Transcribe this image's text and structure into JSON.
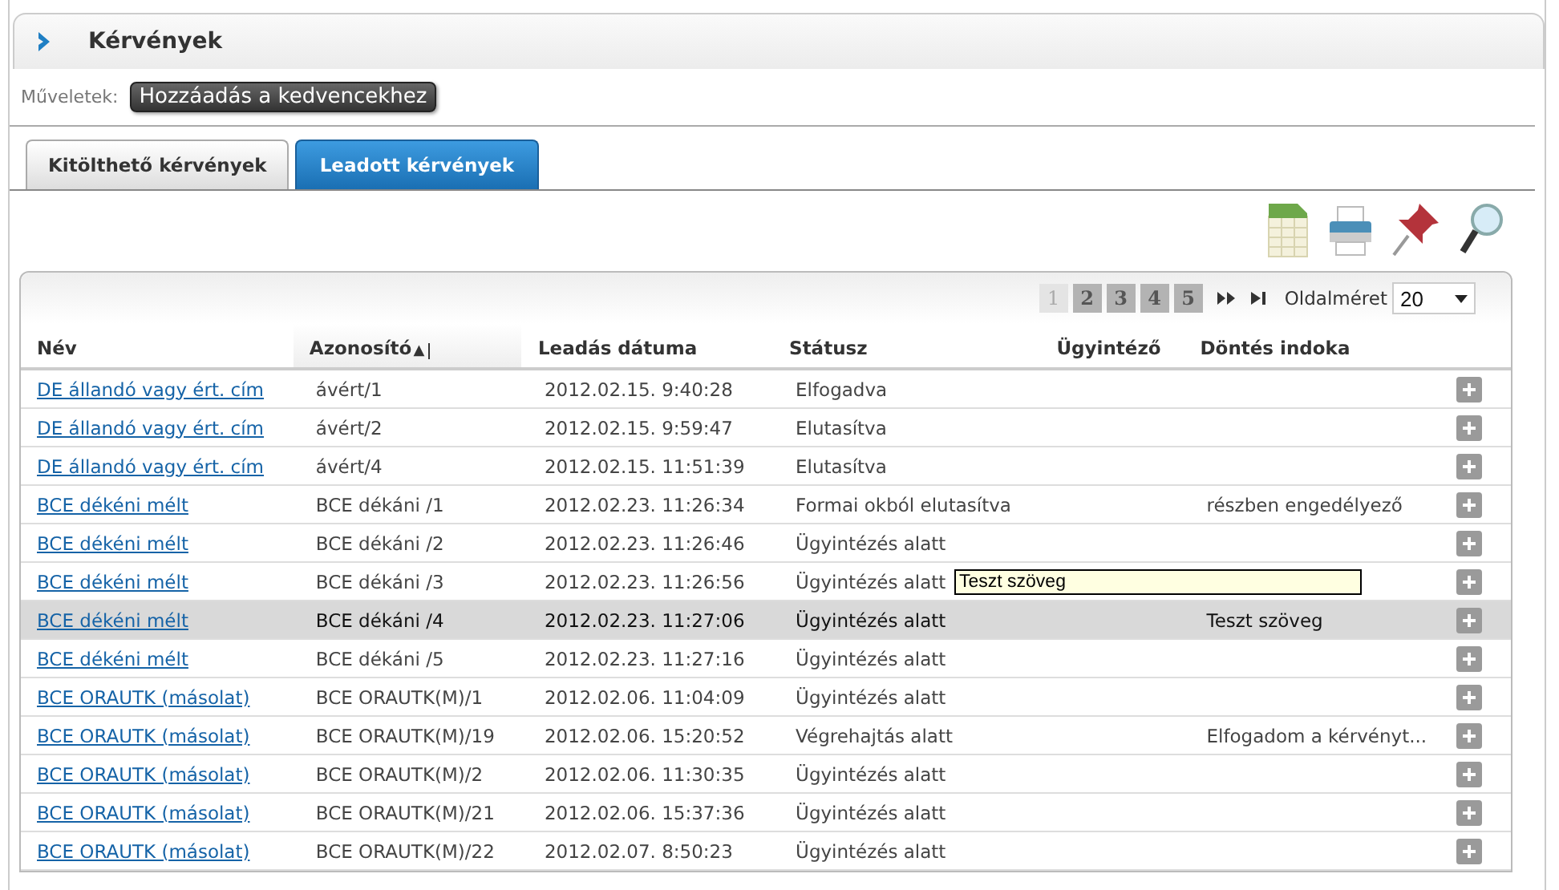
{
  "panel": {
    "title": "Kérvények"
  },
  "actions": {
    "label": "Műveletek:",
    "buttons": [
      "Hozzáadás a kedvencekhez"
    ]
  },
  "tabs": [
    {
      "label": "Kitölthető kérvények",
      "selected": false
    },
    {
      "label": "Leadott kérvények",
      "selected": true
    }
  ],
  "pager": {
    "pages": [
      {
        "label": "1",
        "selected": true
      },
      {
        "label": "2",
        "selected": false
      },
      {
        "label": "3",
        "selected": false
      },
      {
        "label": "4",
        "selected": false
      },
      {
        "label": "5",
        "selected": false
      }
    ],
    "page_size_label": "Oldalméret",
    "page_size": "20"
  },
  "table": {
    "columns": [
      {
        "label": "Név",
        "sorted": false
      },
      {
        "label": "Azonosító",
        "sorted": true,
        "sort_mark": "▲"
      },
      {
        "label": "Leadás dátuma",
        "sorted": false
      },
      {
        "label": "Státusz",
        "sorted": false
      },
      {
        "label": "Ügyintéző",
        "sorted": false
      },
      {
        "label": "Döntés indoka",
        "sorted": false
      }
    ],
    "rows": [
      {
        "name": "DE állandó vagy ért. cím",
        "id": "ávért/1",
        "date": "2012.02.15. 9:40:28",
        "status": "Elfogadva",
        "reason": "",
        "selected": false
      },
      {
        "name": "DE állandó vagy ért. cím",
        "id": "ávért/2",
        "date": "2012.02.15. 9:59:47",
        "status": "Elutasítva",
        "reason": "",
        "selected": false
      },
      {
        "name": "DE állandó vagy ért. cím",
        "id": "ávért/4",
        "date": "2012.02.15. 11:51:39",
        "status": "Elutasítva",
        "reason": "",
        "selected": false
      },
      {
        "name": "BCE dékéni mélt",
        "id": "BCE dékáni /1",
        "date": "2012.02.23. 11:26:34",
        "status": "Formai okból elutasítva",
        "reason": "részben engedélyező",
        "selected": false
      },
      {
        "name": "BCE dékéni mélt",
        "id": "BCE dékáni /2",
        "date": "2012.02.23. 11:26:46",
        "status": "Ügyintézés alatt",
        "reason": "",
        "selected": false
      },
      {
        "name": "BCE dékéni mélt",
        "id": "BCE dékáni /3",
        "date": "2012.02.23. 11:26:56",
        "status": "Ügyintézés alatt",
        "reason": "",
        "selected": false
      },
      {
        "name": "BCE dékéni mélt",
        "id": "BCE dékáni /4",
        "date": "2012.02.23. 11:27:06",
        "status": "Ügyintézés alatt",
        "reason": "Teszt szöveg",
        "selected": true
      },
      {
        "name": "BCE dékéni mélt",
        "id": "BCE dékáni /5",
        "date": "2012.02.23. 11:27:16",
        "status": "Ügyintézés alatt",
        "reason": "",
        "selected": false
      },
      {
        "name": "BCE ORAUTK (másolat)",
        "id": "BCE ORAUTK(M)/1",
        "date": "2012.02.06. 11:04:09",
        "status": "Ügyintézés alatt",
        "reason": "",
        "selected": false
      },
      {
        "name": "BCE ORAUTK (másolat)",
        "id": "BCE ORAUTK(M)/19",
        "date": "2012.02.06. 15:20:52",
        "status": "Végrehajtás alatt",
        "reason": "Elfogadom a kérvényt...",
        "selected": false
      },
      {
        "name": "BCE ORAUTK (másolat)",
        "id": "BCE ORAUTK(M)/2",
        "date": "2012.02.06. 11:30:35",
        "status": "Ügyintézés alatt",
        "reason": "",
        "selected": false
      },
      {
        "name": "BCE ORAUTK (másolat)",
        "id": "BCE ORAUTK(M)/21",
        "date": "2012.02.06. 15:37:36",
        "status": "Ügyintézés alatt",
        "reason": "",
        "selected": false
      },
      {
        "name": "BCE ORAUTK (másolat)",
        "id": "BCE ORAUTK(M)/22",
        "date": "2012.02.07. 8:50:23",
        "status": "Ügyintézés alatt",
        "reason": "",
        "selected": false
      }
    ]
  },
  "tooltip": {
    "text": "Teszt szöveg"
  }
}
